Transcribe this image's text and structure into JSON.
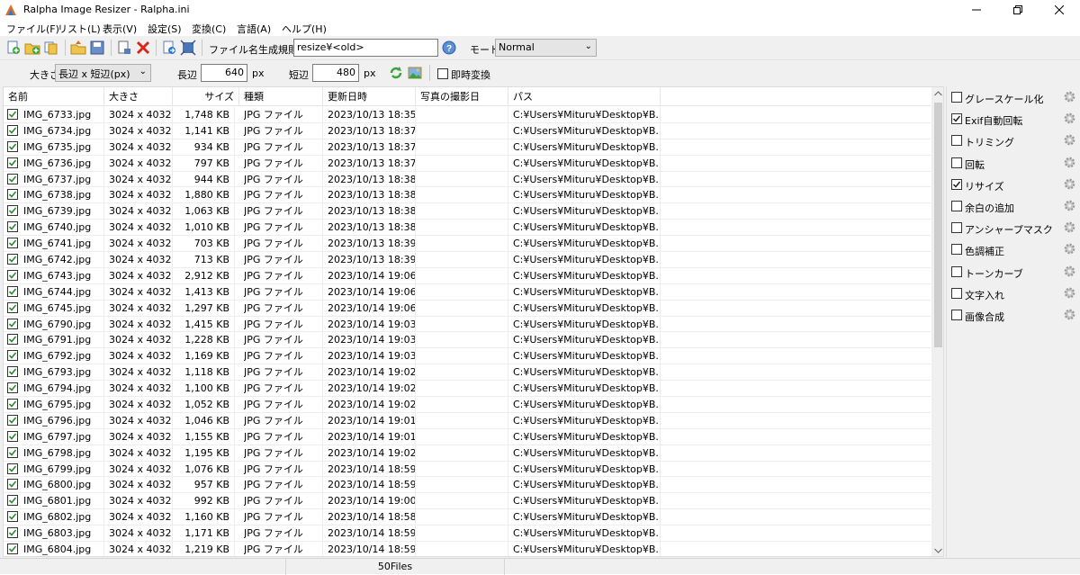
{
  "window": {
    "title": "Ralpha Image Resizer - Ralpha.ini"
  },
  "menu": [
    "ファイル(F)",
    "リスト(L)",
    "表示(V)",
    "設定(S)",
    "変換(C)",
    "言語(A)",
    "ヘルプ(H)"
  ],
  "toolbar1": {
    "filename_rule_label": "ファイル名生成規則",
    "filename_rule_value": "resize¥<old>",
    "mode_label": "モード",
    "mode_value": "Normal"
  },
  "toolbar2": {
    "size_label": "大きさ",
    "size_mode": "長辺 x 短辺(px)",
    "long_label": "長辺",
    "long_value": "640",
    "long_unit": "px",
    "short_label": "短辺",
    "short_value": "480",
    "short_unit": "px",
    "instant_label": "即時変換",
    "instant_checked": false
  },
  "columns": [
    "名前",
    "大きさ",
    "サイズ",
    "種類",
    "更新日時",
    "写真の撮影日",
    "パス"
  ],
  "rows": [
    {
      "name": "IMG_6733.jpg",
      "dim": "3024 x 4032",
      "size": "1,748 KB",
      "type": "JPG ファイル",
      "date": "2023/10/13 18:35",
      "shot": "",
      "path": "C:¥Users¥Mituru¥Desktop¥B..."
    },
    {
      "name": "IMG_6734.jpg",
      "dim": "3024 x 4032",
      "size": "1,141 KB",
      "type": "JPG ファイル",
      "date": "2023/10/13 18:37",
      "shot": "",
      "path": "C:¥Users¥Mituru¥Desktop¥B..."
    },
    {
      "name": "IMG_6735.jpg",
      "dim": "3024 x 4032",
      "size": "934 KB",
      "type": "JPG ファイル",
      "date": "2023/10/13 18:37",
      "shot": "",
      "path": "C:¥Users¥Mituru¥Desktop¥B..."
    },
    {
      "name": "IMG_6736.jpg",
      "dim": "3024 x 4032",
      "size": "797 KB",
      "type": "JPG ファイル",
      "date": "2023/10/13 18:37",
      "shot": "",
      "path": "C:¥Users¥Mituru¥Desktop¥B..."
    },
    {
      "name": "IMG_6737.jpg",
      "dim": "3024 x 4032",
      "size": "944 KB",
      "type": "JPG ファイル",
      "date": "2023/10/13 18:38",
      "shot": "",
      "path": "C:¥Users¥Mituru¥Desktop¥B..."
    },
    {
      "name": "IMG_6738.jpg",
      "dim": "3024 x 4032",
      "size": "1,880 KB",
      "type": "JPG ファイル",
      "date": "2023/10/13 18:38",
      "shot": "",
      "path": "C:¥Users¥Mituru¥Desktop¥B..."
    },
    {
      "name": "IMG_6739.jpg",
      "dim": "3024 x 4032",
      "size": "1,063 KB",
      "type": "JPG ファイル",
      "date": "2023/10/13 18:38",
      "shot": "",
      "path": "C:¥Users¥Mituru¥Desktop¥B..."
    },
    {
      "name": "IMG_6740.jpg",
      "dim": "3024 x 4032",
      "size": "1,010 KB",
      "type": "JPG ファイル",
      "date": "2023/10/13 18:38",
      "shot": "",
      "path": "C:¥Users¥Mituru¥Desktop¥B..."
    },
    {
      "name": "IMG_6741.jpg",
      "dim": "3024 x 4032",
      "size": "703 KB",
      "type": "JPG ファイル",
      "date": "2023/10/13 18:39",
      "shot": "",
      "path": "C:¥Users¥Mituru¥Desktop¥B..."
    },
    {
      "name": "IMG_6742.jpg",
      "dim": "3024 x 4032",
      "size": "713 KB",
      "type": "JPG ファイル",
      "date": "2023/10/13 18:39",
      "shot": "",
      "path": "C:¥Users¥Mituru¥Desktop¥B..."
    },
    {
      "name": "IMG_6743.jpg",
      "dim": "3024 x 4032",
      "size": "2,912 KB",
      "type": "JPG ファイル",
      "date": "2023/10/14 19:06",
      "shot": "",
      "path": "C:¥Users¥Mituru¥Desktop¥B..."
    },
    {
      "name": "IMG_6744.jpg",
      "dim": "3024 x 4032",
      "size": "1,413 KB",
      "type": "JPG ファイル",
      "date": "2023/10/14 19:06",
      "shot": "",
      "path": "C:¥Users¥Mituru¥Desktop¥B..."
    },
    {
      "name": "IMG_6745.jpg",
      "dim": "3024 x 4032",
      "size": "1,297 KB",
      "type": "JPG ファイル",
      "date": "2023/10/14 19:06",
      "shot": "",
      "path": "C:¥Users¥Mituru¥Desktop¥B..."
    },
    {
      "name": "IMG_6790.jpg",
      "dim": "3024 x 4032",
      "size": "1,415 KB",
      "type": "JPG ファイル",
      "date": "2023/10/14 19:03",
      "shot": "",
      "path": "C:¥Users¥Mituru¥Desktop¥B..."
    },
    {
      "name": "IMG_6791.jpg",
      "dim": "3024 x 4032",
      "size": "1,228 KB",
      "type": "JPG ファイル",
      "date": "2023/10/14 19:03",
      "shot": "",
      "path": "C:¥Users¥Mituru¥Desktop¥B..."
    },
    {
      "name": "IMG_6792.jpg",
      "dim": "3024 x 4032",
      "size": "1,169 KB",
      "type": "JPG ファイル",
      "date": "2023/10/14 19:03",
      "shot": "",
      "path": "C:¥Users¥Mituru¥Desktop¥B..."
    },
    {
      "name": "IMG_6793.jpg",
      "dim": "3024 x 4032",
      "size": "1,118 KB",
      "type": "JPG ファイル",
      "date": "2023/10/14 19:02",
      "shot": "",
      "path": "C:¥Users¥Mituru¥Desktop¥B..."
    },
    {
      "name": "IMG_6794.jpg",
      "dim": "3024 x 4032",
      "size": "1,100 KB",
      "type": "JPG ファイル",
      "date": "2023/10/14 19:02",
      "shot": "",
      "path": "C:¥Users¥Mituru¥Desktop¥B..."
    },
    {
      "name": "IMG_6795.jpg",
      "dim": "3024 x 4032",
      "size": "1,052 KB",
      "type": "JPG ファイル",
      "date": "2023/10/14 19:02",
      "shot": "",
      "path": "C:¥Users¥Mituru¥Desktop¥B..."
    },
    {
      "name": "IMG_6796.jpg",
      "dim": "3024 x 4032",
      "size": "1,046 KB",
      "type": "JPG ファイル",
      "date": "2023/10/14 19:01",
      "shot": "",
      "path": "C:¥Users¥Mituru¥Desktop¥B..."
    },
    {
      "name": "IMG_6797.jpg",
      "dim": "3024 x 4032",
      "size": "1,155 KB",
      "type": "JPG ファイル",
      "date": "2023/10/14 19:01",
      "shot": "",
      "path": "C:¥Users¥Mituru¥Desktop¥B..."
    },
    {
      "name": "IMG_6798.jpg",
      "dim": "3024 x 4032",
      "size": "1,195 KB",
      "type": "JPG ファイル",
      "date": "2023/10/14 19:02",
      "shot": "",
      "path": "C:¥Users¥Mituru¥Desktop¥B..."
    },
    {
      "name": "IMG_6799.jpg",
      "dim": "3024 x 4032",
      "size": "1,076 KB",
      "type": "JPG ファイル",
      "date": "2023/10/14 18:59",
      "shot": "",
      "path": "C:¥Users¥Mituru¥Desktop¥B..."
    },
    {
      "name": "IMG_6800.jpg",
      "dim": "3024 x 4032",
      "size": "957 KB",
      "type": "JPG ファイル",
      "date": "2023/10/14 18:59",
      "shot": "",
      "path": "C:¥Users¥Mituru¥Desktop¥B..."
    },
    {
      "name": "IMG_6801.jpg",
      "dim": "3024 x 4032",
      "size": "992 KB",
      "type": "JPG ファイル",
      "date": "2023/10/14 19:00",
      "shot": "",
      "path": "C:¥Users¥Mituru¥Desktop¥B..."
    },
    {
      "name": "IMG_6802.jpg",
      "dim": "3024 x 4032",
      "size": "1,160 KB",
      "type": "JPG ファイル",
      "date": "2023/10/14 18:58",
      "shot": "",
      "path": "C:¥Users¥Mituru¥Desktop¥B..."
    },
    {
      "name": "IMG_6803.jpg",
      "dim": "3024 x 4032",
      "size": "1,171 KB",
      "type": "JPG ファイル",
      "date": "2023/10/14 18:59",
      "shot": "",
      "path": "C:¥Users¥Mituru¥Desktop¥B..."
    },
    {
      "name": "IMG_6804.jpg",
      "dim": "3024 x 4032",
      "size": "1,219 KB",
      "type": "JPG ファイル",
      "date": "2023/10/14 18:59",
      "shot": "",
      "path": "C:¥Users¥Mituru¥Desktop¥B..."
    }
  ],
  "side_options": [
    {
      "label": "グレースケール化",
      "checked": false
    },
    {
      "label": "Exif自動回転",
      "checked": true
    },
    {
      "label": "トリミング",
      "checked": false
    },
    {
      "label": "回転",
      "checked": false
    },
    {
      "label": "リサイズ",
      "checked": true
    },
    {
      "label": "余白の追加",
      "checked": false
    },
    {
      "label": "アンシャープマスク",
      "checked": false
    },
    {
      "label": "色調補正",
      "checked": false
    },
    {
      "label": "トーンカーブ",
      "checked": false
    },
    {
      "label": "文字入れ",
      "checked": false
    },
    {
      "label": "画像合成",
      "checked": false
    }
  ],
  "status": {
    "count": "50Files"
  },
  "icons": [
    "add-file-icon",
    "add-folder-icon",
    "add-multiple-icon",
    "open-folder-icon",
    "save-list-icon",
    "clear-list-icon",
    "delete-icon",
    "export-icon",
    "fit-icon",
    "help-icon",
    "refresh-icon",
    "image-icon",
    "gear-icon"
  ]
}
